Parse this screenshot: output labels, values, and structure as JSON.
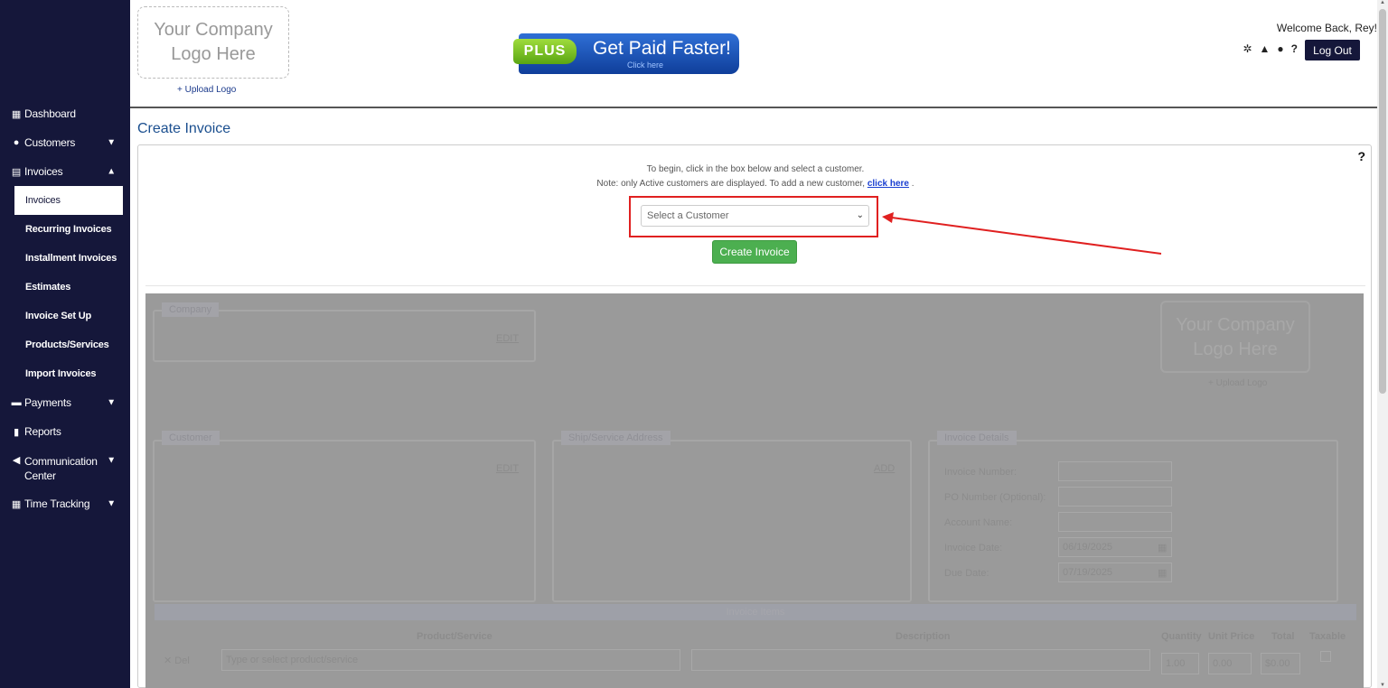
{
  "sidebar": {
    "items": [
      {
        "label": "Dashboard",
        "icon": "grid-icon"
      },
      {
        "label": "Customers",
        "icon": "user-icon"
      },
      {
        "label": "Invoices",
        "icon": "file-icon"
      },
      {
        "label": "Payments",
        "icon": "card-icon"
      },
      {
        "label": "Reports",
        "icon": "bar-chart-icon"
      },
      {
        "label": "Communication Center",
        "icon": "megaphone-icon"
      },
      {
        "label": "Time Tracking",
        "icon": "calendar-icon"
      }
    ],
    "invoice_sub": [
      "Invoices",
      "Recurring Invoices",
      "Installment Invoices",
      "Estimates",
      "Invoice Set Up",
      "Products/Services",
      "Import Invoices"
    ]
  },
  "header": {
    "logo_text": "Your Company Logo Here",
    "upload_logo": "+ Upload Logo",
    "promo_plus": "PLUS",
    "promo_text": "Get Paid Faster!",
    "promo_click": "Click here",
    "welcome": "Welcome Back, Rey!",
    "logout": "Log Out"
  },
  "main": {
    "page_title": "Create Invoice",
    "help": "?",
    "instr_line1": "To begin, click in the box below and select a customer.",
    "instr_line2_pre": "Note: only Active customers are displayed. To add a new customer,",
    "instr_link": "click here",
    "instr_line2_post": ".",
    "select_placeholder": "Select a Customer",
    "create_button": "Create Invoice"
  },
  "form": {
    "company_tag": "Company",
    "edit1": "EDIT",
    "logo_text": "Your Company Logo Here",
    "upload_logo": "+ Upload Logo",
    "customer_tag": "Customer",
    "edit2": "EDIT",
    "ship_tag": "Ship/Service Address",
    "add": "ADD",
    "details_tag": "Invoice Details",
    "invoice_number": "Invoice Number:",
    "po_number": "PO Number (Optional):",
    "account_name": "Account Name:",
    "invoice_date": "Invoice Date:",
    "invoice_date_val": "06/19/2025",
    "due_date": "Due Date:",
    "due_date_val": "07/19/2025",
    "items_bar": "Invoice Items",
    "col_product": "Product/Service",
    "col_description": "Description",
    "col_quantity": "Quantity",
    "col_unit_price": "Unit Price",
    "col_total": "Total",
    "col_taxable": "Taxable",
    "row_delete": "Del",
    "product_placeholder": "Type or select product/service",
    "qty_val": "1.00",
    "price_val": "0.00",
    "total_val": "$0.00"
  },
  "colors": {
    "sidebar": "#15173a",
    "accent": "#1b4f8f",
    "create": "#4caf50",
    "highlight": "#e02020"
  }
}
